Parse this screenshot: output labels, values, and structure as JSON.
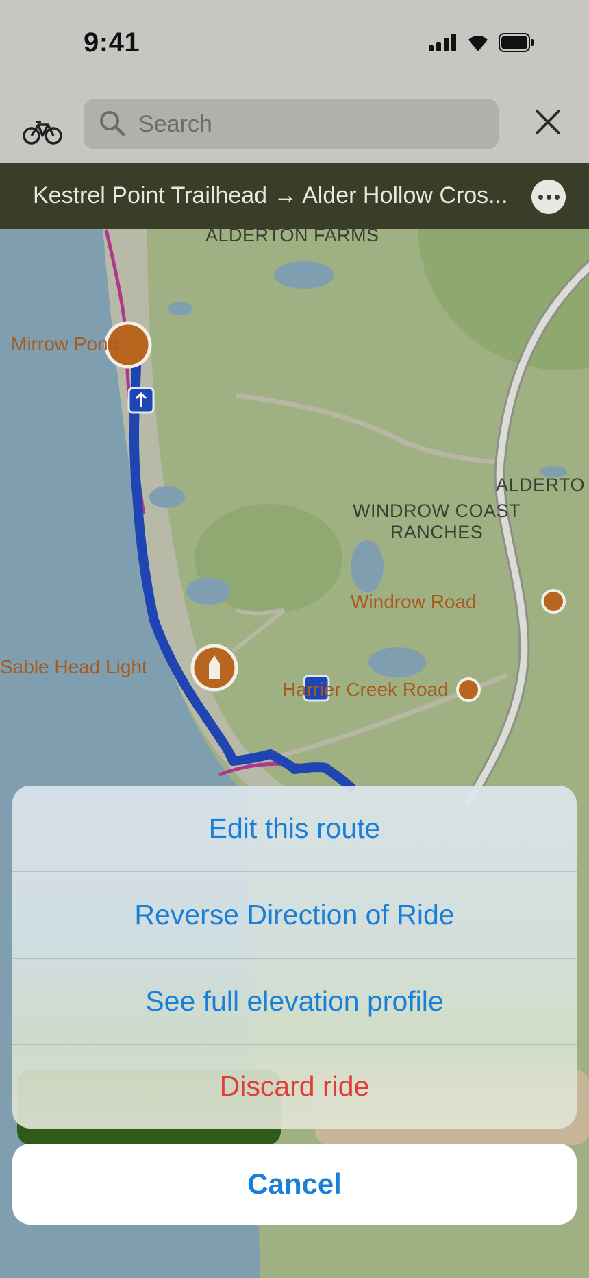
{
  "status_bar": {
    "time": "9:41"
  },
  "search": {
    "placeholder": "Search",
    "icon": "magnifier-icon"
  },
  "route": {
    "title": "Kestrel Point Trailhead → Alder Hollow Cros..."
  },
  "map": {
    "places": {
      "alderton_farms": "ALDERTON FARMS",
      "windrow_coast_line1": "WINDROW COAST",
      "windrow_coast_line2": "RANCHES",
      "alderto": "ALDERTO"
    },
    "pois": {
      "mirrow_pond": "Mirrow Pond",
      "sable_head_light": "Sable Head Light",
      "windrow_road": "Windrow Road",
      "harrier_creek_road": "Harrier Creek Road"
    },
    "colors": {
      "water": "#7f9fb0",
      "land": "#9fb083",
      "route": "#1f45b3",
      "poi": "#b8651f"
    }
  },
  "actions": {
    "edit": "Edit this route",
    "reverse": "Reverse Direction of Ride",
    "elevation": "See full elevation profile",
    "discard": "Discard ride"
  },
  "cancel": "Cancel"
}
